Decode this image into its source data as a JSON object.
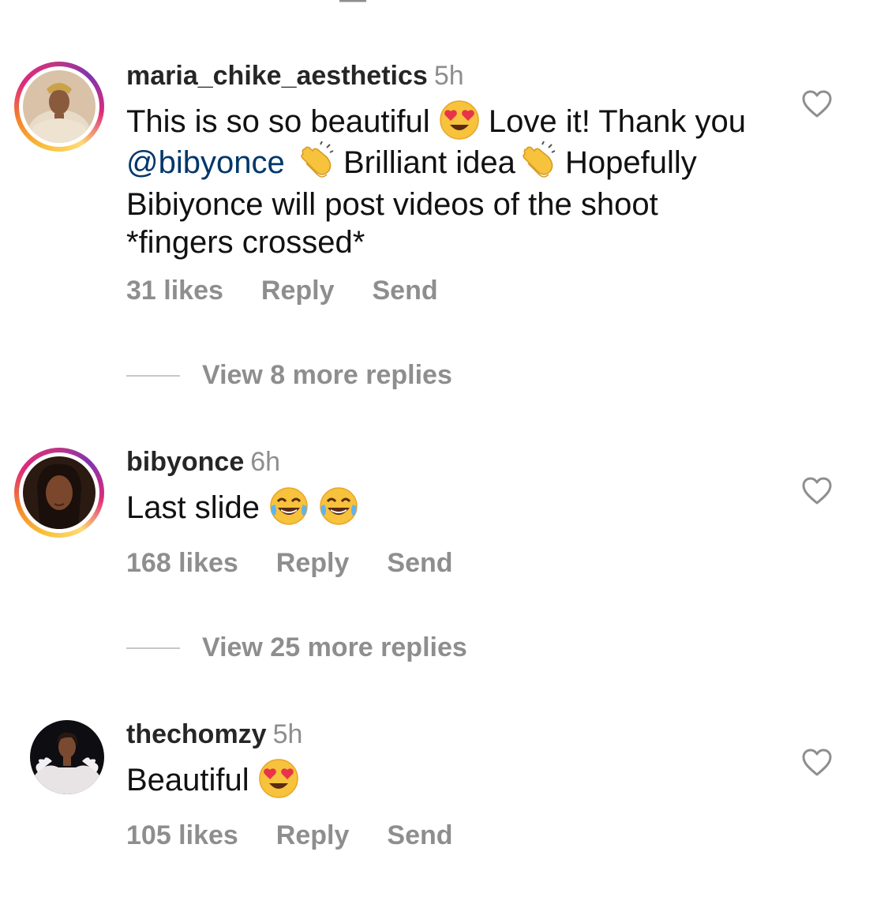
{
  "comments": [
    {
      "username": "maria_chike_aesthetics",
      "time": "5h",
      "text_parts": {
        "p1": "This is so so beautiful",
        "p2": "Love it! Thank you",
        "mention": "@bibyonce",
        "p3": "Brilliant idea",
        "p4": "Hopefully Bibiyonce will post videos of the shoot *fingers crossed*"
      },
      "likes": "31 likes",
      "reply": "Reply",
      "send": "Send",
      "view_replies": "View 8 more replies"
    },
    {
      "username": "bibyonce",
      "time": "6h",
      "text": "Last slide",
      "likes": "168 likes",
      "reply": "Reply",
      "send": "Send",
      "view_replies": "View 25 more replies"
    },
    {
      "username": "thechomzy",
      "time": "5h",
      "text": "Beautiful",
      "likes": "105 likes",
      "reply": "Reply",
      "send": "Send"
    }
  ],
  "icons": {
    "like": "heart-outline-icon",
    "emoji_heart_eyes": "heart-eyes-emoji",
    "emoji_clap": "clapping-hands-emoji",
    "emoji_laugh": "tears-of-joy-emoji"
  },
  "colors": {
    "text": "#111111",
    "muted": "#8e8e8e",
    "mention": "#00376b",
    "divider": "#c7c7c7"
  }
}
